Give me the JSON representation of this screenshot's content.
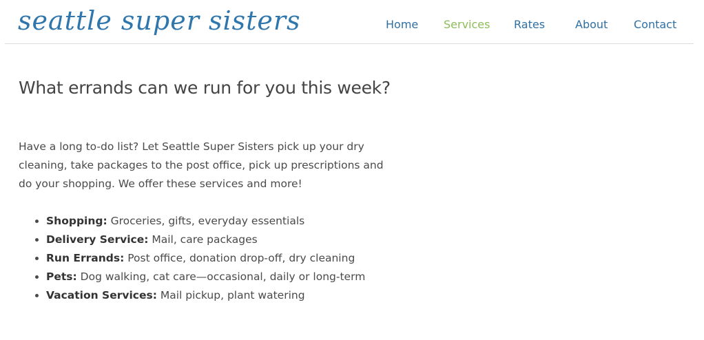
{
  "header": {
    "logo_text": "seattle super sisters",
    "nav": [
      {
        "label": "Home",
        "active": false
      },
      {
        "label": "Services",
        "active": true
      },
      {
        "label": "Rates",
        "active": false
      },
      {
        "label": "About",
        "active": false
      },
      {
        "label": "Contact",
        "active": false
      }
    ]
  },
  "colors": {
    "brand_blue": "#2f76ad",
    "nav_active_green": "#8cbd59",
    "nav_link_blue": "#2f6fa3"
  },
  "main": {
    "heading": "What errands can we run for you this week?",
    "intro": "Have a long to-do list? Let Seattle Super Sisters pick up your dry cleaning, take packages to the post office, pick up prescriptions and do your shopping. We offer these services and more!",
    "services": [
      {
        "term": "Shopping:",
        "description": " Groceries, gifts, everyday essentials"
      },
      {
        "term": "Delivery Service:",
        "description": " Mail, care packages"
      },
      {
        "term": "Run Errands:",
        "description": " Post office, donation drop-off, dry cleaning"
      },
      {
        "term": "Pets:",
        "description": " Dog walking, cat care—occasional, daily or long-term"
      },
      {
        "term": "Vacation Services:",
        "description": " Mail pickup, plant watering"
      }
    ]
  }
}
